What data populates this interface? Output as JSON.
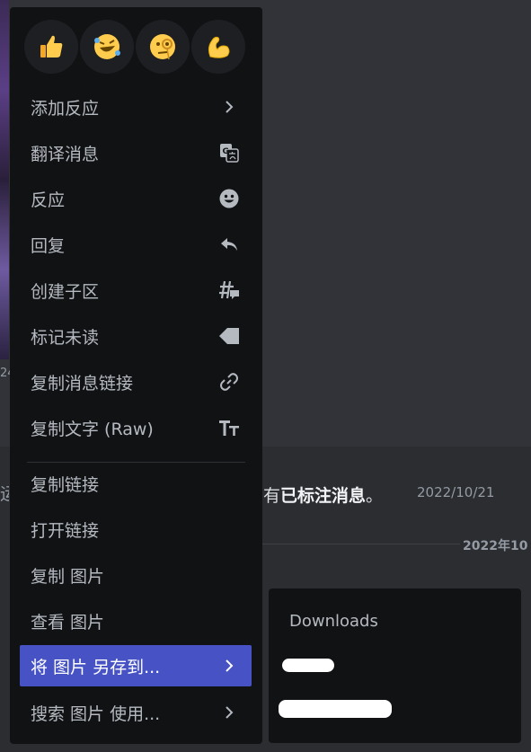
{
  "background": {
    "fragment_24": "24",
    "message_prefix": "有",
    "message_bold": "已标注消息",
    "message_suffix": "。",
    "message_date": "2022/10/21",
    "left_fragment": "运",
    "divider_date": "2022年10"
  },
  "reactions": [
    {
      "name": "thumbs-up",
      "glyph": "👍"
    },
    {
      "name": "rolling-on-floor-laughing",
      "glyph": "🤣"
    },
    {
      "name": "face-with-monocle",
      "glyph": "🧐"
    },
    {
      "name": "flexed-biceps",
      "glyph": "💪"
    }
  ],
  "menu": {
    "add_reaction": "添加反应",
    "translate": "翻译消息",
    "react": "反应",
    "reply": "回复",
    "create_thread": "创建子区",
    "mark_unread": "标记未读",
    "copy_message_link": "复制消息链接",
    "copy_text": "复制文字 (Raw)",
    "copy_link": "复制链接",
    "open_link": "打开链接",
    "copy_image": "复制 图片",
    "view_image": "查看 图片",
    "save_image_to": "将 图片 另存到...",
    "search_image_with": "搜索 图片 使用..."
  },
  "submenu": {
    "title": "Downloads"
  },
  "colors": {
    "accent": "#4752c4",
    "menu_bg": "#111214",
    "text": "#b5bac1"
  }
}
